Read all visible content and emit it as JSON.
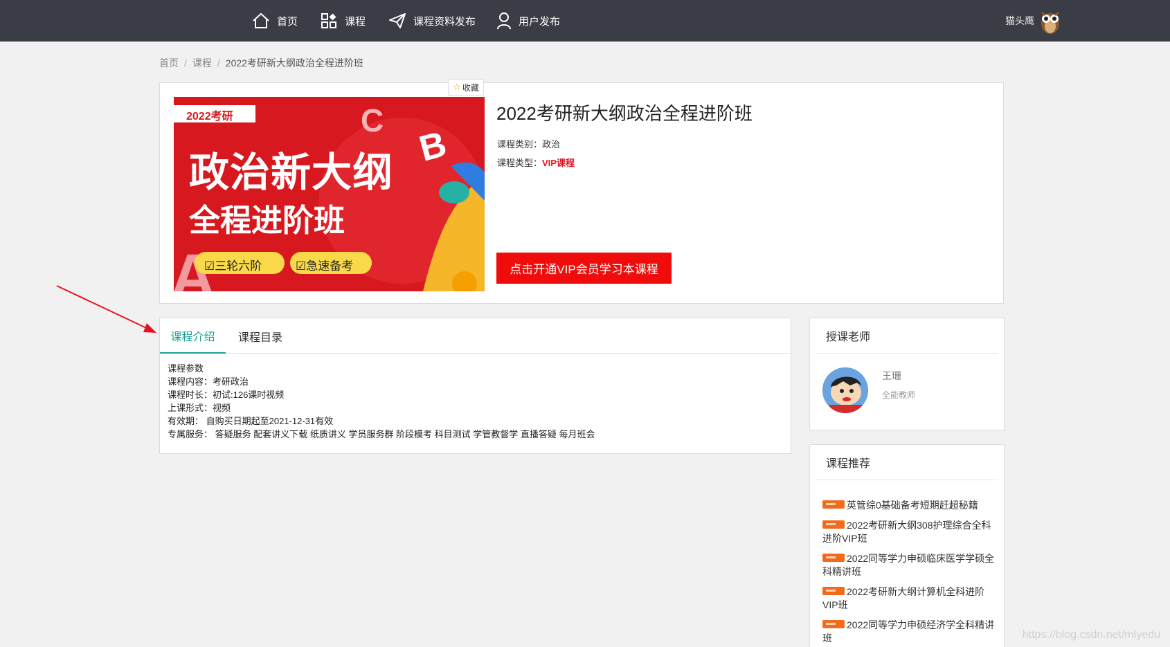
{
  "nav": {
    "items": [
      {
        "label": "首页",
        "icon": "home-icon"
      },
      {
        "label": "课程",
        "icon": "grid-icon"
      },
      {
        "label": "课程资料发布",
        "icon": "paper-plane-icon"
      },
      {
        "label": "用户发布",
        "icon": "user-icon"
      }
    ],
    "user_name": "猫头鹰"
  },
  "breadcrumb": [
    "首页",
    "课程",
    "2022考研新大纲政治全程进阶班"
  ],
  "course": {
    "fav_label": "收藏",
    "cover": {
      "tag": "2022考研",
      "headline1": "政治新大纲",
      "headline2": "全程进阶班",
      "pill1": "三轮六阶",
      "pill2": "急速备考"
    },
    "title": "2022考研新大纲政治全程进阶班",
    "category_label": "课程类别：",
    "category_value": "政治",
    "type_label": "课程类型：",
    "type_value": "VIP课程",
    "vip_button": "点击开通VIP会员学习本课程"
  },
  "tabs": [
    "课程介绍",
    "课程目录"
  ],
  "intro": {
    "lines": [
      "课程参数",
      "课程内容：考研政治",
      "课程时长：初试:126课时视频",
      "上课形式：视频",
      "有效期：  自购买日期起至2021-12-31有效",
      "专属服务：  答疑服务 配套讲义下载 纸质讲义 学员服务群 阶段模考 科目测试 学管教督学 直播答疑 每月班会"
    ]
  },
  "teacher": {
    "section_title": "授课老师",
    "name": "王珊",
    "role": "全能教师"
  },
  "recommend": {
    "section_title": "课程推荐",
    "items": [
      "英管综0基础备考短期赶超秘籍",
      "2022考研新大纲308护理综合全科进阶VIP班",
      "2022同等学力申硕临床医学学硕全科精讲班",
      "2022考研新大纲计算机全科进阶VIP班",
      "2022同等学力申硕经济学全科精讲班"
    ]
  },
  "watermark": "https://blog.csdn.net/mlyedu",
  "colors": {
    "topbar": "#3a3d45",
    "accent_green": "#1aa094",
    "vip_red": "#f10c0c",
    "hot_orange": "#f26b1d"
  }
}
